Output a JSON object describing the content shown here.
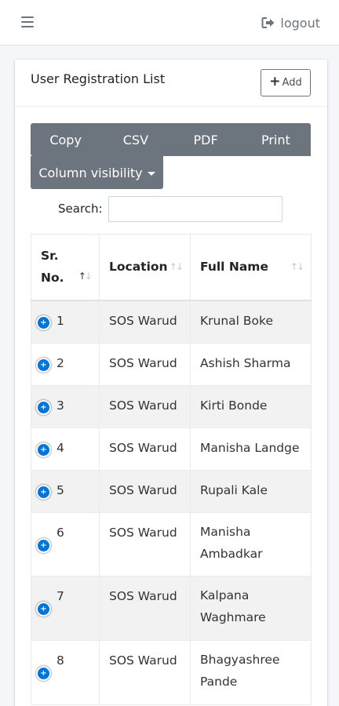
{
  "header": {
    "menu_icon": "hamburger-icon",
    "logout_icon": "sign-out-icon",
    "logout_label": "logout"
  },
  "card": {
    "title": "User Registration List",
    "add_label": "Add",
    "add_icon": "plus-icon"
  },
  "buttons": {
    "copy": "Copy",
    "csv": "CSV",
    "pdf": "PDF",
    "print": "Print",
    "column_visibility": "Column visibility"
  },
  "search": {
    "label": "Search:",
    "value": "",
    "placeholder": ""
  },
  "table": {
    "columns": [
      {
        "label": "Sr. No.",
        "sort": "ascending"
      },
      {
        "label": "Location",
        "sort": "none"
      },
      {
        "label": "Full Name",
        "sort": "none"
      }
    ],
    "rows": [
      {
        "sr": "1",
        "location": "SOS Warud",
        "name": "Krunal Boke"
      },
      {
        "sr": "2",
        "location": "SOS Warud",
        "name": "Ashish Sharma"
      },
      {
        "sr": "3",
        "location": "SOS Warud",
        "name": "Kirti Bonde"
      },
      {
        "sr": "4",
        "location": "SOS Warud",
        "name": "Manisha Landge"
      },
      {
        "sr": "5",
        "location": "SOS Warud",
        "name": "Rupali Kale"
      },
      {
        "sr": "6",
        "location": "SOS Warud",
        "name": "Manisha Ambadkar"
      },
      {
        "sr": "7",
        "location": "SOS Warud",
        "name": "Kalpana Waghmare"
      },
      {
        "sr": "8",
        "location": "SOS Warud",
        "name": "Bhagyashree Pande"
      }
    ]
  },
  "colors": {
    "button_gray": "#6c757d",
    "expand_blue": "#0275d8",
    "stripe": "#f2f2f2"
  }
}
